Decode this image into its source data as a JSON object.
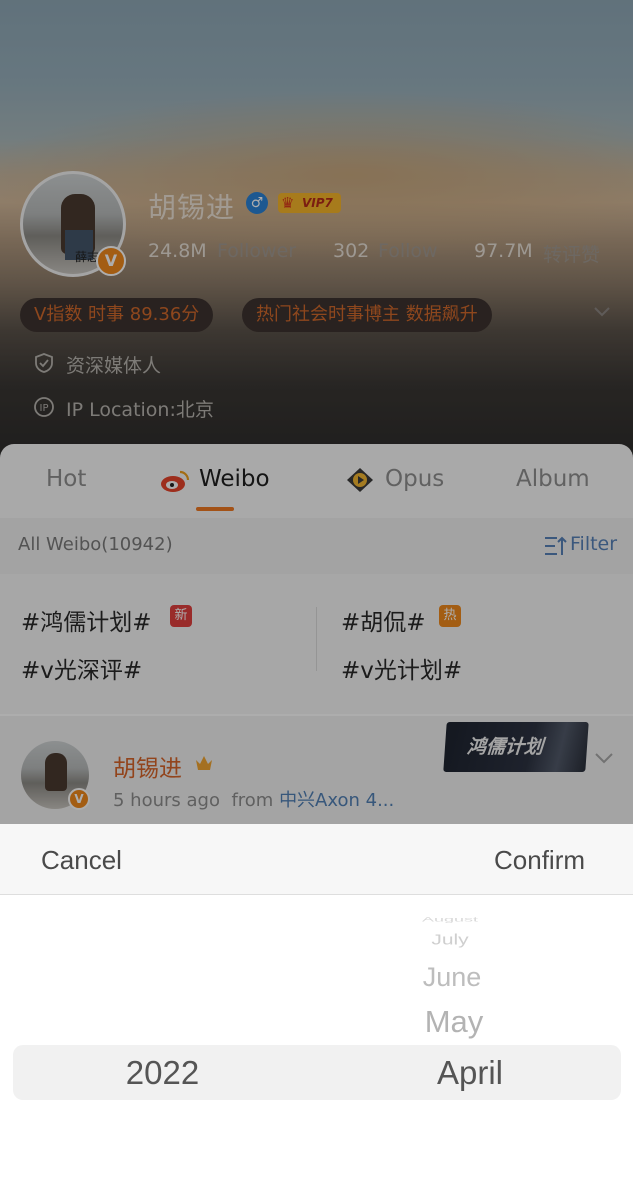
{
  "profile": {
    "name": "胡锡进",
    "vip_label": "VIP7",
    "followers_num": "24.8M",
    "followers_lbl": "Follower",
    "follow_num": "302",
    "follow_lbl": "Follow",
    "likes_num": "97.7M",
    "likes_lbl": "转评赞",
    "chips": [
      "V指数 时事 89.36分",
      "热门社会时事博主 数据飙升"
    ],
    "info": [
      "资深媒体人",
      "IP Location:北京"
    ],
    "avatar_ink": "薛志"
  },
  "tabs": [
    "Hot",
    "Weibo",
    "Opus",
    "Album"
  ],
  "subbar": {
    "label": "All Weibo(10942)",
    "filter": "Filter"
  },
  "topics": [
    {
      "text": "#鸿儒计划#",
      "tag": "新",
      "tag_color": "#e2403f"
    },
    {
      "text": "#胡侃#",
      "tag": "热",
      "tag_color": "#f08a1c"
    },
    {
      "text": "#v光深评#"
    },
    {
      "text": "#v光计划#"
    }
  ],
  "post": {
    "author": "胡锡进",
    "time": "5 hours ago",
    "from": "from",
    "source": "中兴Axon 4...",
    "promo": "鸿儒计划"
  },
  "picker": {
    "cancel": "Cancel",
    "confirm": "Confirm",
    "year_selected": "2022",
    "months_above": [
      "August",
      "July",
      "June",
      "May"
    ],
    "month_selected": "April"
  },
  "colors": {
    "accent": "#f07a22",
    "link": "#5180b6",
    "orange_name": "#d8652a"
  }
}
